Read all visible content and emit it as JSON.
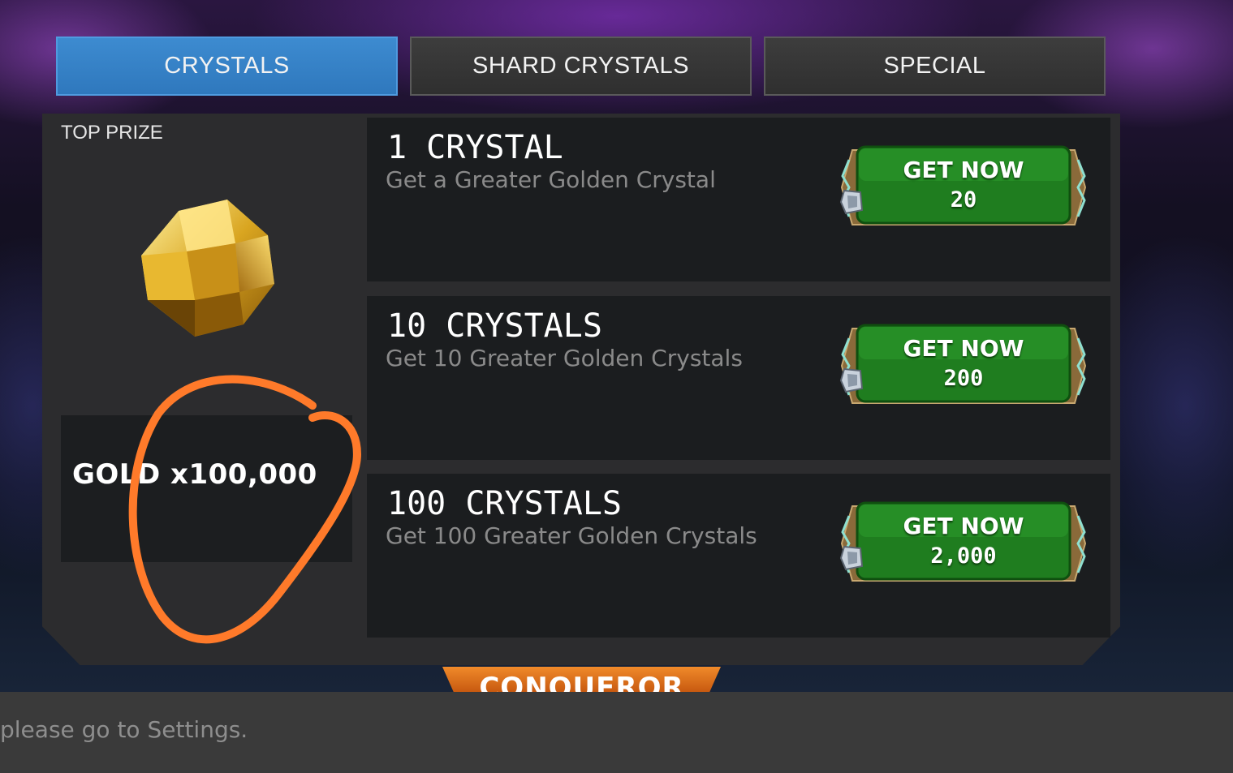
{
  "tabs": [
    {
      "label": "CRYSTALS",
      "active": true
    },
    {
      "label": "SHARD CRYSTALS",
      "active": false
    },
    {
      "label": "SPECIAL",
      "active": false
    }
  ],
  "top_prize": {
    "label": "TOP PRIZE",
    "icon": "gold-crystal-icon",
    "reward": "GOLD x100,000"
  },
  "offers": [
    {
      "title": "1 CRYSTAL",
      "description": "Get a Greater Golden Crystal",
      "button_label": "GET NOW",
      "price": "20",
      "currency_icon": "unit-currency-icon"
    },
    {
      "title": "10 CRYSTALS",
      "description": "Get 10 Greater Golden Crystals",
      "button_label": "GET NOW",
      "price": "200",
      "currency_icon": "unit-currency-icon"
    },
    {
      "title": "100 CRYSTALS",
      "description": "Get 100 Greater Golden Crystals",
      "button_label": "GET NOW",
      "price": "2,000",
      "currency_icon": "unit-currency-icon"
    }
  ],
  "banner": {
    "label": "CONQUEROR"
  },
  "notification": {
    "text": "please go to Settings."
  },
  "colors": {
    "active_tab": "#2f78bd",
    "button_green": "#1d7a1d",
    "annotation": "#ff7a2a",
    "banner": "#e0761d"
  }
}
